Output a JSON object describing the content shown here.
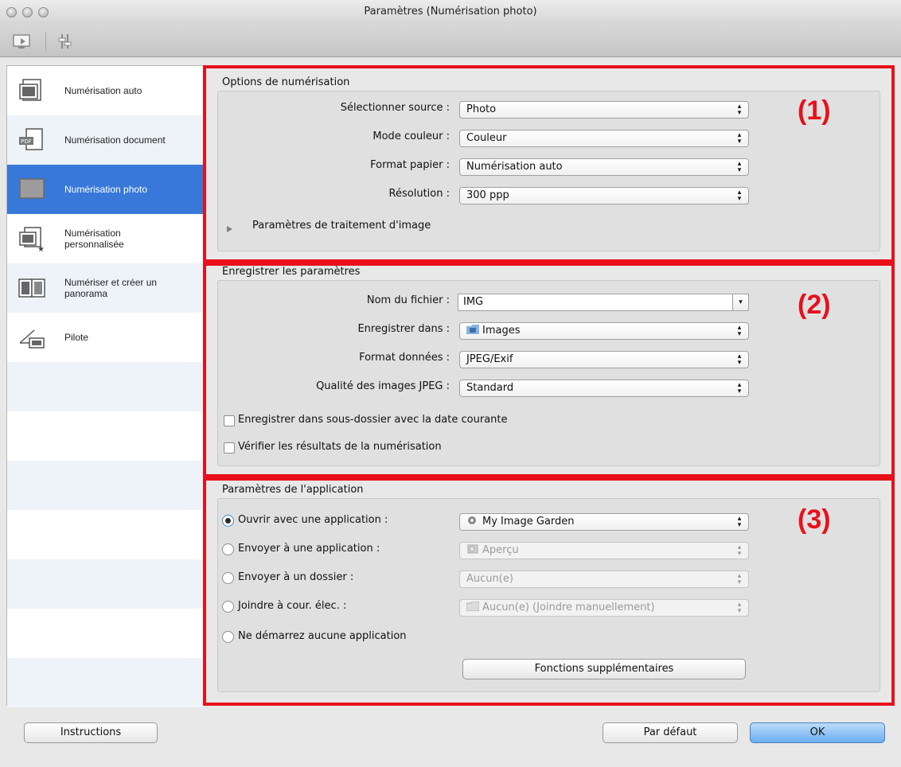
{
  "window": {
    "title": "Paramètres (Numérisation photo)"
  },
  "toolbar": {
    "tabs": [
      "scan-from-computer-icon",
      "general-settings-icon"
    ]
  },
  "sidebar": {
    "items": [
      {
        "label": "Numérisation auto",
        "icon": "auto-scan-icon"
      },
      {
        "label": "Numérisation document",
        "icon": "document-scan-icon"
      },
      {
        "label": "Numérisation photo",
        "icon": "photo-scan-icon"
      },
      {
        "label": "Numérisation personnalisée",
        "icon": "custom-scan-icon"
      },
      {
        "label": "Numériser et créer un panorama",
        "icon": "panorama-scan-icon"
      },
      {
        "label": "Pilote",
        "icon": "driver-icon"
      }
    ],
    "selected": "Numérisation photo"
  },
  "scan_options": {
    "title": "Options de numérisation",
    "marker": "(1)",
    "source_label": "Sélectionner source :",
    "source_value": "Photo",
    "color_label": "Mode couleur :",
    "color_value": "Couleur",
    "paper_label": "Format papier :",
    "paper_value": "Numérisation auto",
    "resolution_label": "Résolution :",
    "resolution_value": "300 ppp",
    "image_processing_label": "Paramètres de traitement d'image"
  },
  "save_settings": {
    "title": "Enregistrer les paramètres",
    "marker": "(2)",
    "filename_label": "Nom du fichier :",
    "filename_value": "IMG",
    "save_in_label": "Enregistrer dans :",
    "save_in_value": "Images",
    "data_format_label": "Format données :",
    "data_format_value": "JPEG/Exif",
    "jpeg_quality_label": "Qualité des images JPEG :",
    "jpeg_quality_value": "Standard",
    "subfolder_label": "Enregistrer dans sous-dossier avec la date courante",
    "subfolder_checked": false,
    "check_results_label": "Vérifier les résultats de la numérisation",
    "check_results_checked": false
  },
  "app_settings": {
    "title": "Paramètres de l'application",
    "marker": "(3)",
    "open_with_label": "Ouvrir avec une application :",
    "open_with_value": "My Image Garden",
    "send_app_label": "Envoyer à une application :",
    "send_app_value": "Aperçu",
    "send_folder_label": "Envoyer à un dossier :",
    "send_folder_value": "Aucun(e)",
    "email_label": "Joindre à cour. élec. :",
    "email_value": "Aucun(e) (Joindre manuellement)",
    "none_label": "Ne démarrez aucune application",
    "selected_option": "Ouvrir avec une application :",
    "extra_button": "Fonctions supplémentaires"
  },
  "footer": {
    "instructions": "Instructions",
    "defaults": "Par défaut",
    "ok": "OK"
  },
  "colors": {
    "highlight_red": "#e8101b",
    "selection_blue": "#3878d8"
  }
}
